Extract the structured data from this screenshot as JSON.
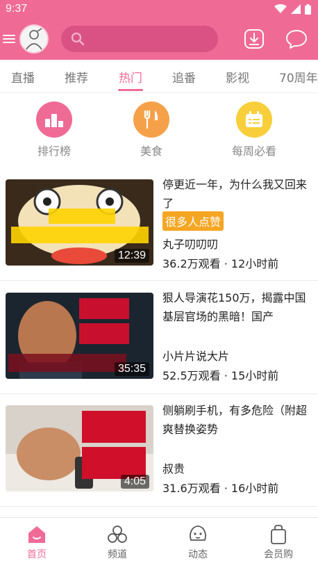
{
  "status_bar": {
    "time": "9:37"
  },
  "app_bar": {
    "search_placeholder": ""
  },
  "tabs": [
    {
      "label": "直播"
    },
    {
      "label": "推荐"
    },
    {
      "label": "热门",
      "active": true
    },
    {
      "label": "追番"
    },
    {
      "label": "影视"
    },
    {
      "label": "70周年"
    }
  ],
  "quick_links": [
    {
      "label": "排行榜",
      "icon": "ranking-icon",
      "color": "#f06a96"
    },
    {
      "label": "美食",
      "icon": "food-icon",
      "color": "#f5a14a"
    },
    {
      "label": "每周必看",
      "icon": "calendar-icon",
      "color": "#f8cf3a"
    }
  ],
  "videos": [
    {
      "title": "停更近一年，为什么我又回来了",
      "tag": "很多人点赞",
      "author": "丸子叨叨叨",
      "meta": "36.2万观看 · 12小时前",
      "duration": "12:39",
      "thumb_text": "浅聊一下\n停更时期的心路历程"
    },
    {
      "title": "狠人导演花150万，揭露中国基层官场的黑暗！国产",
      "tag": "",
      "author": "小片片说大片",
      "meta": "52.5万观看 · 15小时前",
      "duration": "35:35",
      "thumb_text": "国产 狠片 揭露基层官场黑暗！"
    },
    {
      "title": "侧躺刷手机，有多危险（附超爽替换姿势",
      "tag": "",
      "author": "叔贵",
      "meta": "31.6万观看 · 16小时前",
      "duration": "4:05",
      "thumb_text": "危险 姿势"
    }
  ],
  "bottom_nav": [
    {
      "label": "首页",
      "active": true
    },
    {
      "label": "频道"
    },
    {
      "label": "动态"
    },
    {
      "label": "会员购"
    }
  ],
  "colors": {
    "brand_pink": "#f06a96",
    "tag_orange": "#f5a623"
  }
}
